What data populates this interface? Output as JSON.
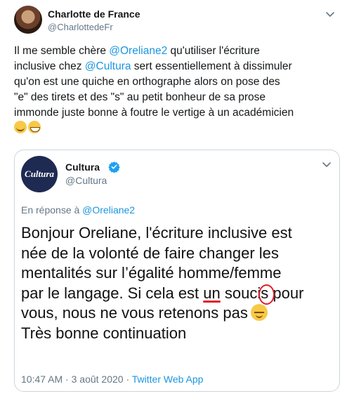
{
  "tweet": {
    "author_name": "Charlotte de France",
    "author_handle": "@CharlottedeFr",
    "lines": [
      [
        {
          "t": "Il me semble chère "
        },
        {
          "t": "@Oreliane2",
          "m": true
        },
        {
          "t": " qu'utiliser l'écriture"
        }
      ],
      [
        {
          "t": "inclusive chez "
        },
        {
          "t": "@Cultura",
          "m": true
        },
        {
          "t": " sert essentiellement à dissimuler"
        }
      ],
      [
        {
          "t": "qu'on est une quiche en orthographe alors on pose des"
        }
      ],
      [
        {
          "t": "\"e\" des tirets et des \"s\" au petit bonheur de sa prose"
        }
      ],
      [
        {
          "t": "immonde juste bonne à foutre le vertige à un académicien"
        }
      ]
    ],
    "emojis": [
      "blushing-face-icon",
      "grinning-face-icon"
    ]
  },
  "quote": {
    "avatar_logo": "Cultura",
    "name": "Cultura",
    "handle": "@Cultura",
    "reply_prefix": "En réponse à ",
    "reply_mention": "@Oreliane2",
    "body": {
      "line1": "Bonjour Oreliane, l'écriture inclusive est",
      "line2": "née de la volonté de faire changer les",
      "line3": "mentalités sur l’égalité homme/femme",
      "line4_pre": "par le langage. Si cela est ",
      "line4_un": "un",
      "line4_souci": " souci",
      "line4_s": "s",
      "line4_post": " pour",
      "line5": "vous, nous ne vous retenons pas",
      "line6": "Très bonne continuation"
    },
    "time": "10:47 AM",
    "date": "3 août 2020",
    "via": "Twitter Web App"
  },
  "colors": {
    "link": "#1b95e0",
    "muted": "#657786",
    "annotation": "#e0202a",
    "verified": "#1da1f2"
  }
}
